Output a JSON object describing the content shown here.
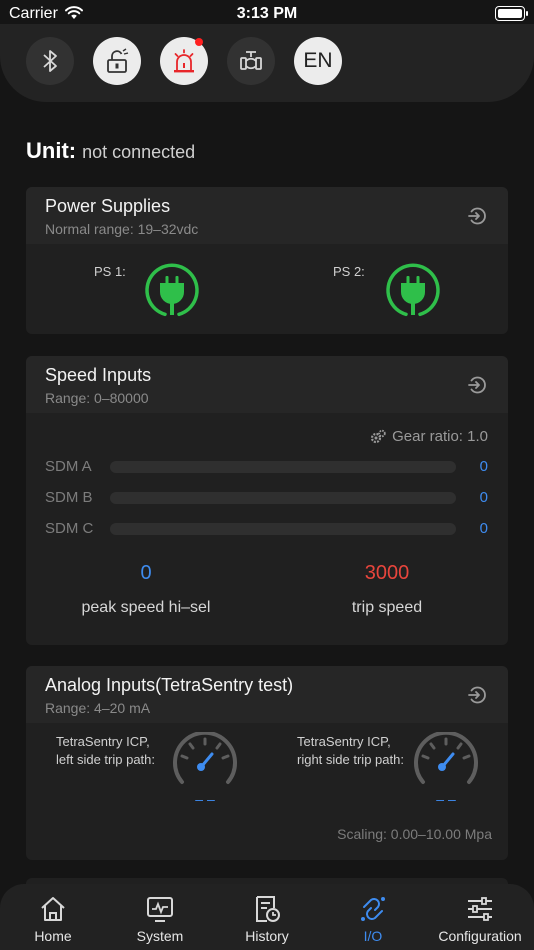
{
  "status_bar": {
    "carrier": "Carrier",
    "time": "3:13 PM"
  },
  "toolbar": {
    "language": "EN",
    "alarm_color": "#ff2020"
  },
  "unit": {
    "label": "Unit:",
    "value": "not connected"
  },
  "power_supplies": {
    "title": "Power Supplies",
    "subtitle": "Normal range: 19–32vdc",
    "ps1_label": "PS 1:",
    "ps2_label": "PS 2:",
    "status_color": "#2fbf4a"
  },
  "speed_inputs": {
    "title": "Speed Inputs",
    "subtitle": "Range: 0–80000",
    "gear_ratio": "Gear ratio: 1.0",
    "sdm": [
      {
        "label": "SDM A",
        "value": "0"
      },
      {
        "label": "SDM B",
        "value": "0"
      },
      {
        "label": "SDM C",
        "value": "0"
      }
    ],
    "peak_value": "0",
    "peak_label": "peak speed hi–sel",
    "trip_value": "3000",
    "trip_label": "trip speed",
    "peak_color": "#3e8cf0",
    "trip_color": "#e8453c"
  },
  "analog_inputs": {
    "title": "Analog Inputs(TetraSentry test)",
    "subtitle": "Range: 4–20 mA",
    "left": {
      "label": "TetraSentry ICP, left side trip path:",
      "value": "– –"
    },
    "right": {
      "label": "TetraSentry ICP, right side trip path:",
      "value": "– –"
    },
    "scaling": "Scaling: 0.00–10.00 Mpa"
  },
  "tabs": [
    {
      "label": "Home",
      "icon": "home-icon"
    },
    {
      "label": "System",
      "icon": "system-icon"
    },
    {
      "label": "History",
      "icon": "history-icon"
    },
    {
      "label": "I/O",
      "icon": "io-icon",
      "active": true
    },
    {
      "label": "Configuration",
      "icon": "sliders-icon"
    }
  ]
}
